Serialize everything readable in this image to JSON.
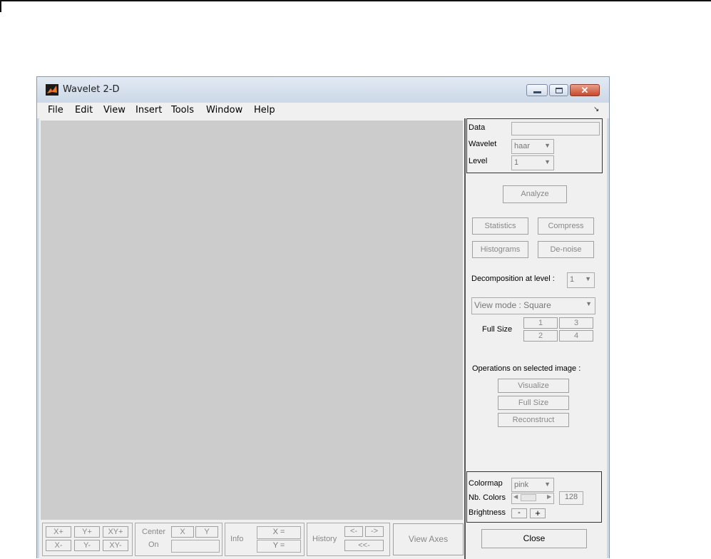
{
  "window": {
    "title": "Wavelet 2-D",
    "controls": {
      "minimize": "minimize",
      "maximize": "maximize",
      "close": "✕"
    }
  },
  "menu": [
    "File",
    "Edit",
    "View",
    "Insert",
    "Tools",
    "Window",
    "Help"
  ],
  "data_panel": {
    "data_label": "Data",
    "data_value": "",
    "wavelet_label": "Wavelet",
    "wavelet_value": "haar",
    "level_label": "Level",
    "level_value": "1"
  },
  "buttons": {
    "analyze": "Analyze",
    "statistics": "Statistics",
    "compress": "Compress",
    "histograms": "Histograms",
    "denoise": "De-noise"
  },
  "decomposition": {
    "label": "Decomposition at level :",
    "value": "1",
    "view_mode": "View mode : Square",
    "full_size_label": "Full Size",
    "full_size_buttons": [
      "1",
      "3",
      "2",
      "4"
    ]
  },
  "operations": {
    "label": "Operations on selected image :",
    "visualize": "Visualize",
    "full_size": "Full Size",
    "reconstruct": "Reconstruct"
  },
  "colormap_panel": {
    "colormap_label": "Colormap",
    "colormap_value": "pink",
    "nb_colors_label": "Nb. Colors",
    "nb_colors_value": "128",
    "brightness_label": "Brightness",
    "brightness_minus": "-",
    "brightness_plus": "+"
  },
  "bottom": {
    "zoom": [
      "X+",
      "Y+",
      "XY+",
      "X-",
      "Y-",
      "XY-"
    ],
    "center_label": "Center",
    "on_label": "On",
    "center_x": "X",
    "center_y": "Y",
    "info_label": "Info",
    "info_x": "X =",
    "info_y": "Y =",
    "history_label": "History",
    "history_back": "<-",
    "history_forward": "->",
    "history_start": "<<-",
    "view_axes": "View Axes",
    "close": "Close"
  }
}
